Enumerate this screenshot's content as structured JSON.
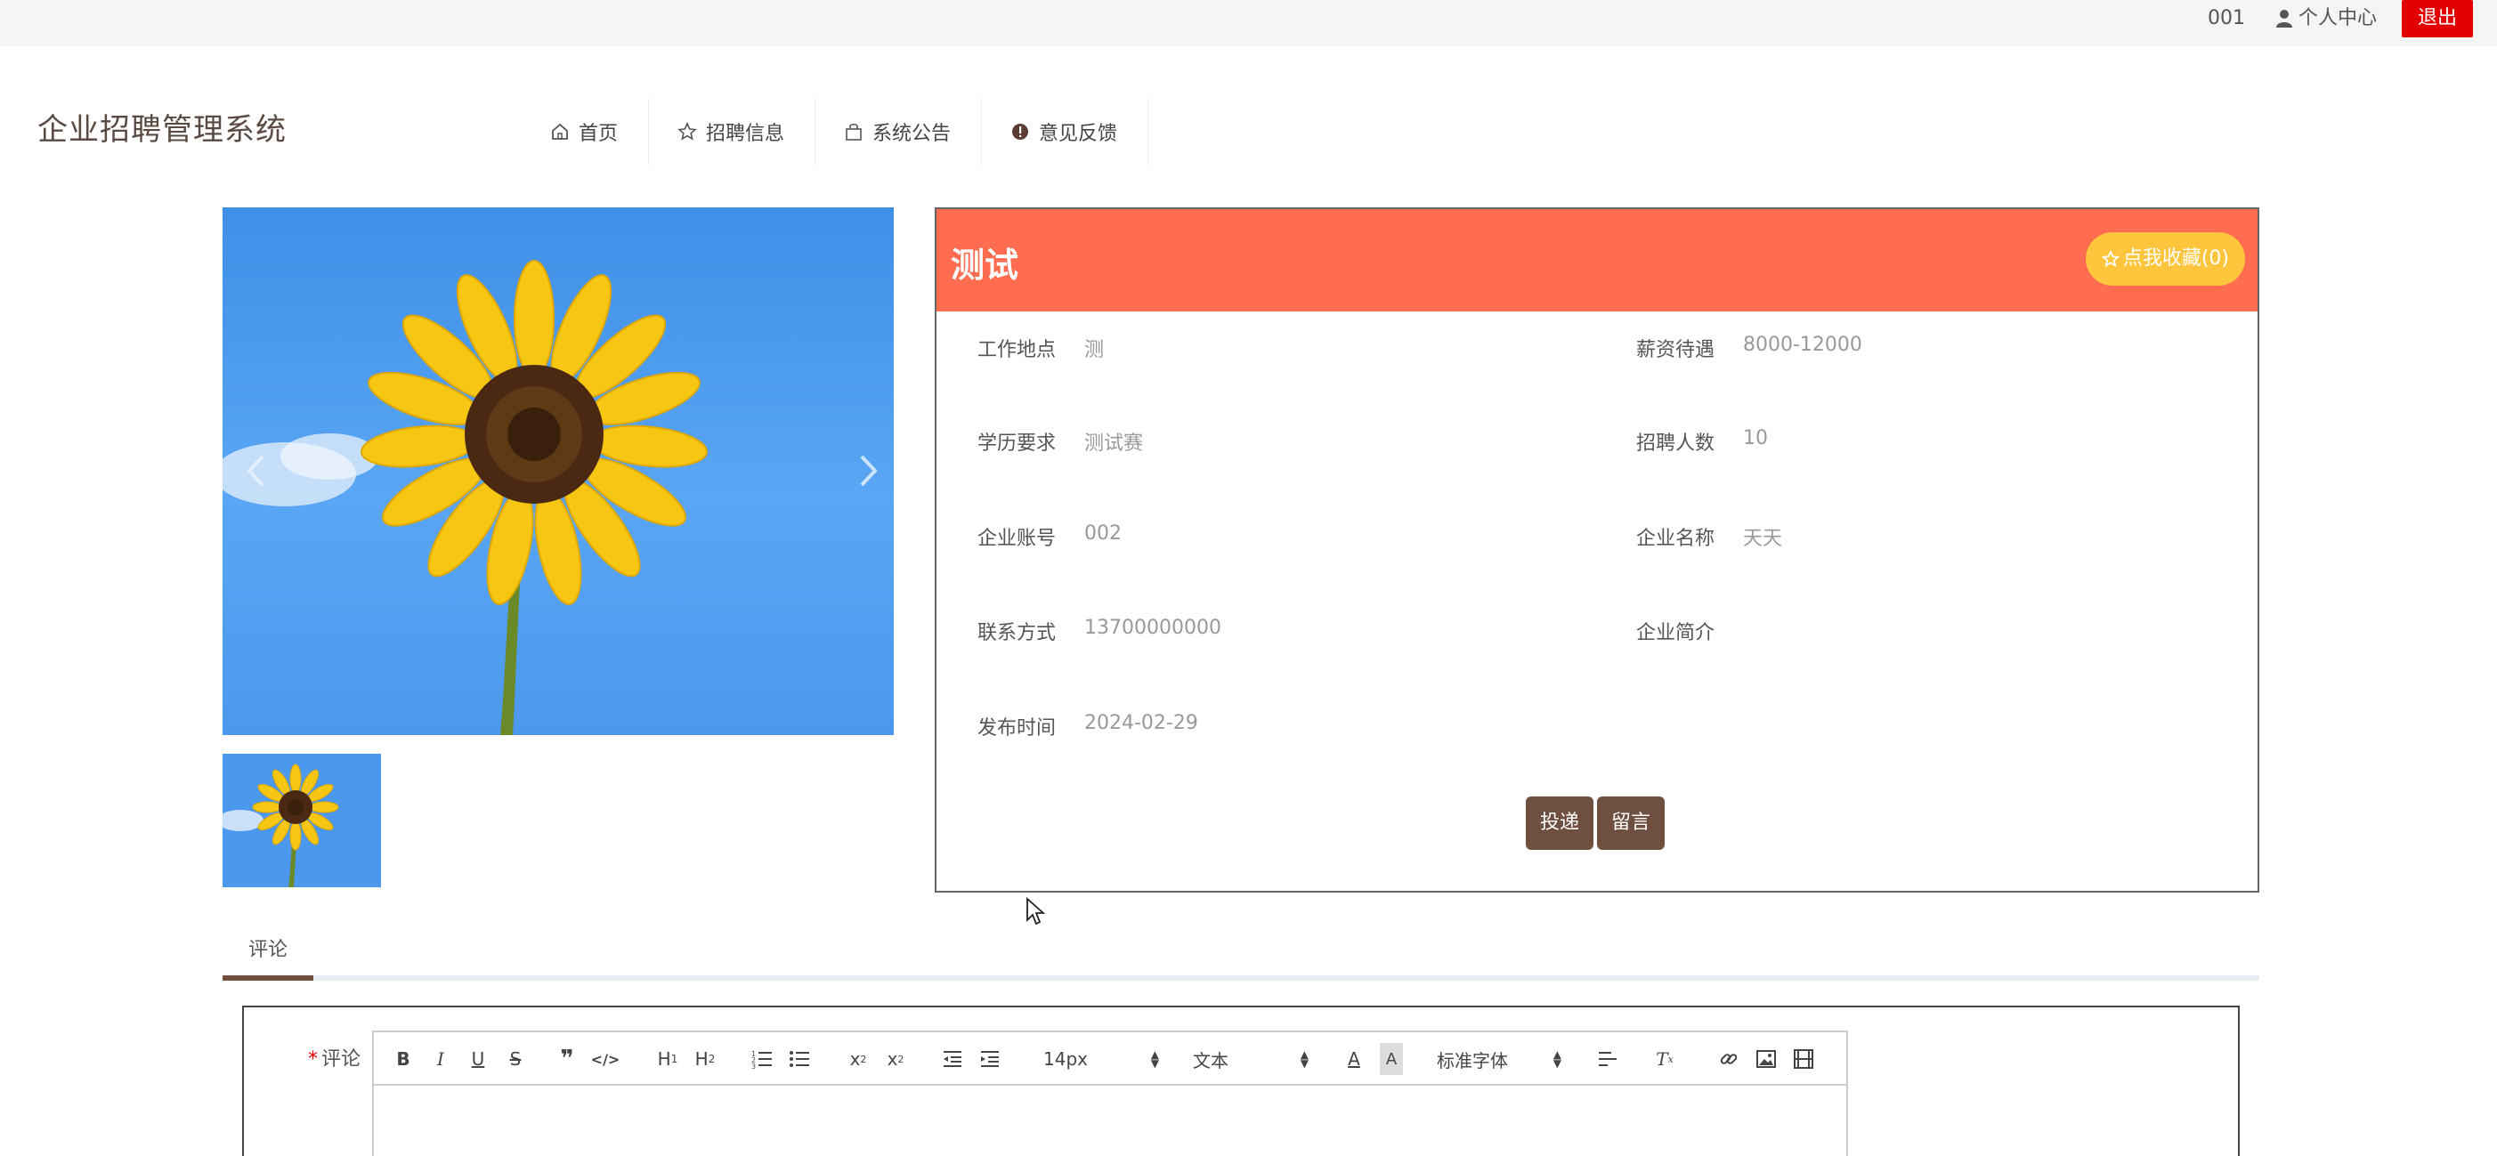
{
  "topbar": {
    "user_id": "001",
    "center_label": "个人中心",
    "logout_label": "退出"
  },
  "header": {
    "site_title": "企业招聘管理系统",
    "nav": [
      {
        "label": "首页",
        "icon": "home-icon"
      },
      {
        "label": "招聘信息",
        "icon": "star-icon"
      },
      {
        "label": "系统公告",
        "icon": "bag-icon"
      },
      {
        "label": "意见反馈",
        "icon": "alert-icon"
      }
    ]
  },
  "job": {
    "title": "测试",
    "favorite_label": "点我收藏(0)",
    "fields": {
      "location_label": "工作地点",
      "location": "测",
      "salary_label": "薪资待遇",
      "salary": "8000-12000",
      "education_label": "学历要求",
      "education": "测试赛",
      "headcount_label": "招聘人数",
      "headcount": "10",
      "account_label": "企业账号",
      "account": "002",
      "company_label": "企业名称",
      "company": "天天",
      "contact_label": "联系方式",
      "contact": "13700000000",
      "intro_label": "企业简介",
      "intro": "",
      "date_label": "发布时间",
      "date": "2024-02-29"
    },
    "apply_label": "投递",
    "message_label": "留言"
  },
  "comments": {
    "tab_label": "评论",
    "field_label": "评论",
    "required_mark": "*",
    "editor": {
      "font_size": "14px",
      "block_type": "文本",
      "font_family": "标准字体"
    }
  },
  "colors": {
    "accent": "#6f4f3f",
    "panel_header": "#ff6c4f",
    "favorite": "#ffc53d",
    "logout": "#e30000"
  }
}
